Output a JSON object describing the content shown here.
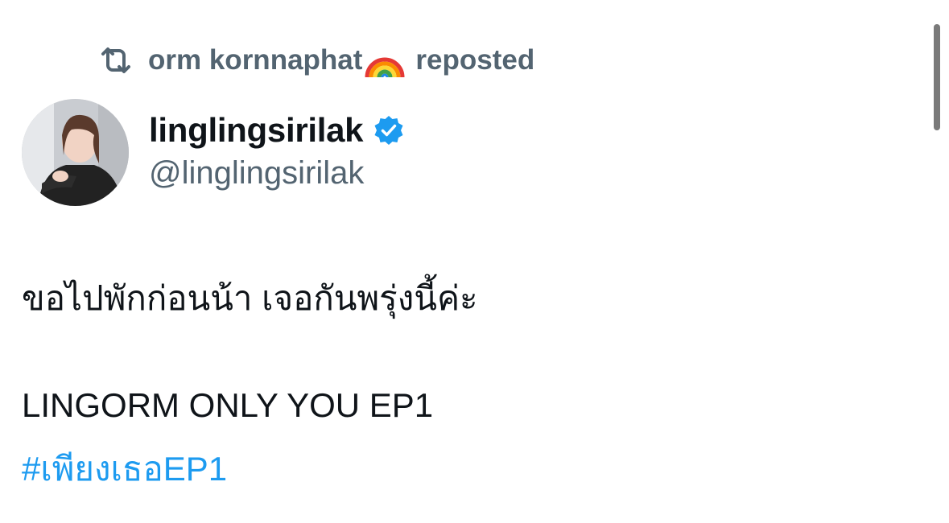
{
  "repost": {
    "reposter_name": "orm kornnaphat",
    "reposted_label": "reposted",
    "icon": "repost-icon",
    "emoji": "rainbow-emoji"
  },
  "author": {
    "display_name": "linglingsirilak",
    "handle": "@linglingsirilak",
    "verified_icon": "verified-badge-icon",
    "avatar_icon": "avatar-photo"
  },
  "tweet": {
    "line1": "ขอไปพักก่อนน้า เจอกันพรุ่งนี้ค่ะ",
    "line2": "LINGORM ONLY YOU EP1",
    "hashtag": "#เพียงเธอEP1"
  },
  "colors": {
    "secondary_text": "#536471",
    "primary_text": "#0f1419",
    "link": "#1d9bf0",
    "verified": "#1d9bf0"
  }
}
